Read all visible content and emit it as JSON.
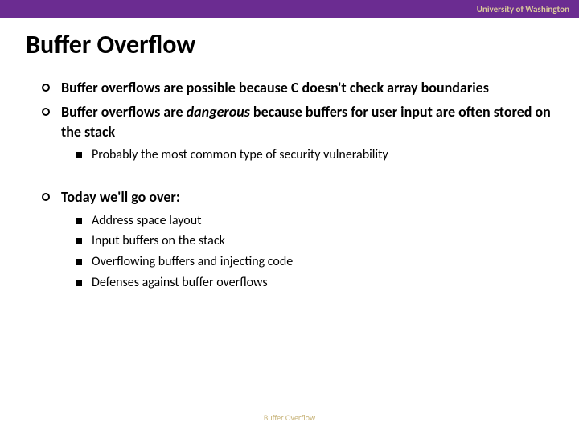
{
  "header": {
    "institution": "University of Washington"
  },
  "title": "Buffer Overflow",
  "bullets": [
    {
      "prefix": "Buffer overflows are possible because C doesn't check array boundaries",
      "italic": "",
      "suffix": ""
    },
    {
      "prefix": "Buffer overflows are ",
      "italic": "dangerous",
      "suffix": " because buffers for user input are often stored on the stack"
    }
  ],
  "sublist1": [
    "Probably the most common type of security vulnerability"
  ],
  "bullet3": "Today we'll go over:",
  "sublist2": [
    "Address space layout",
    "Input buffers on the stack",
    "Overflowing buffers and injecting code",
    "Defenses against buffer overflows"
  ],
  "footer": "Buffer Overflow"
}
